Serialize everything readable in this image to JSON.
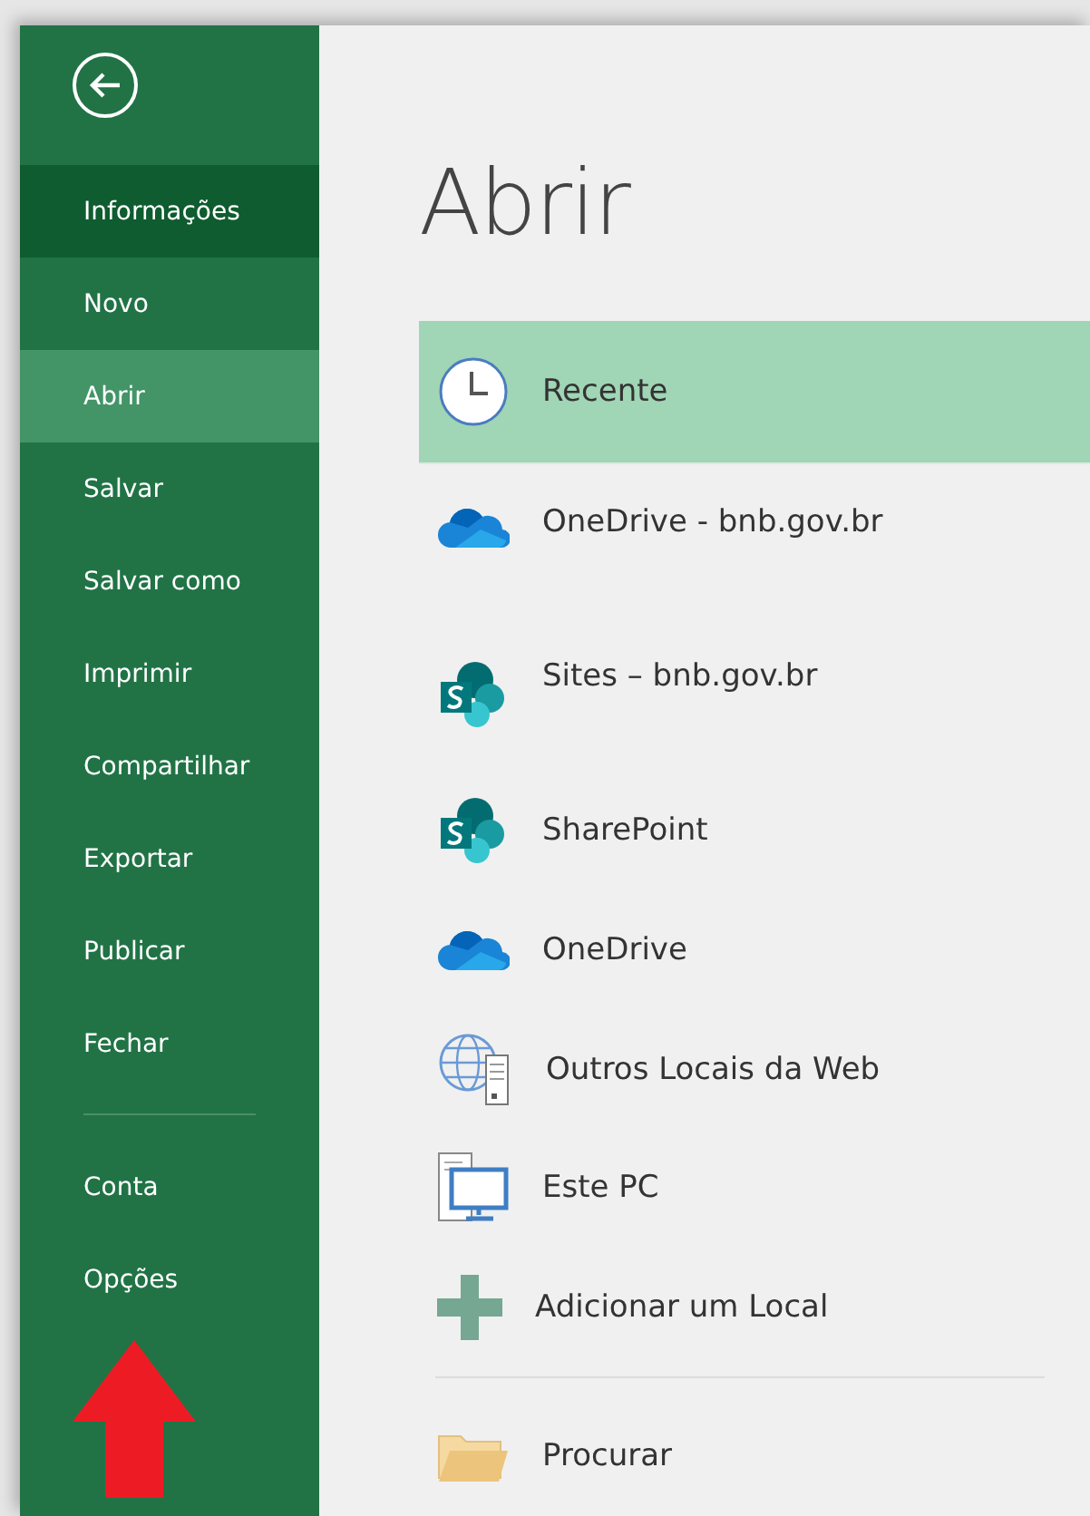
{
  "sidebar": {
    "items": [
      {
        "label": "Informações",
        "selected": false,
        "hovered": true
      },
      {
        "label": "Novo",
        "selected": false,
        "hovered": false
      },
      {
        "label": "Abrir",
        "selected": true,
        "hovered": false
      },
      {
        "label": "Salvar",
        "selected": false,
        "hovered": false
      },
      {
        "label": "Salvar como",
        "selected": false,
        "hovered": false
      },
      {
        "label": "Imprimir",
        "selected": false,
        "hovered": false
      },
      {
        "label": "Compartilhar",
        "selected": false,
        "hovered": false
      },
      {
        "label": "Exportar",
        "selected": false,
        "hovered": false
      },
      {
        "label": "Publicar",
        "selected": false,
        "hovered": false
      },
      {
        "label": "Fechar",
        "selected": false,
        "hovered": false
      }
    ],
    "footer_items": [
      {
        "label": "Conta",
        "selected": false,
        "hovered": false
      },
      {
        "label": "Opções",
        "selected": false,
        "hovered": false
      }
    ]
  },
  "title": "Abrir",
  "places": [
    {
      "label": "Recente",
      "kind": "plain",
      "selected": true
    },
    {
      "label": "OneDrive - bnb.gov.br",
      "kind": "account",
      "selected": false
    },
    {
      "label": "Sites – bnb.gov.br",
      "kind": "account",
      "selected": false
    },
    {
      "label": "SharePoint",
      "kind": "plain",
      "selected": false
    },
    {
      "label": "OneDrive",
      "kind": "plain",
      "selected": false
    },
    {
      "label": "Outros Locais da Web",
      "kind": "plain",
      "selected": false
    },
    {
      "label": "Este PC",
      "kind": "plain",
      "selected": false
    },
    {
      "label": "Adicionar um Local",
      "kind": "plain",
      "selected": false
    }
  ],
  "browse": {
    "label": "Procurar"
  }
}
